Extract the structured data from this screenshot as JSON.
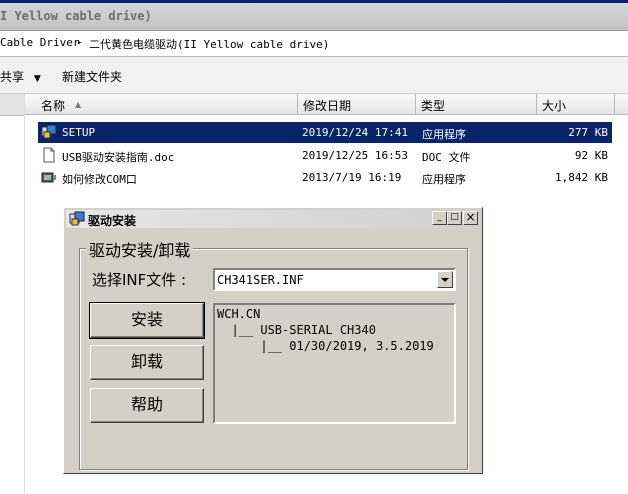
{
  "explorer": {
    "title_fragment": "I Yellow cable drive)",
    "address_path_1": "Cable Driver",
    "address_path_2": "二代黄色电缆驱动(II Yellow cable drive)",
    "toolbar": {
      "share": "共享",
      "new_folder": "新建文件夹"
    },
    "columns": {
      "name": "名称",
      "modified": "修改日期",
      "type": "类型",
      "size": "大小"
    },
    "files": [
      {
        "name": "SETUP",
        "modified": "2019/12/24 17:41",
        "type": "应用程序",
        "size": "277 KB",
        "icon": "setup-app-icon",
        "selected": true
      },
      {
        "name": "USB驱动安装指南.doc",
        "modified": "2019/12/25 16:53",
        "type": "DOC 文件",
        "size": "92 KB",
        "icon": "document-icon",
        "selected": false
      },
      {
        "name": "如何修改COM口",
        "modified": "2013/7/19 16:19",
        "type": "应用程序",
        "size": "1,842 KB",
        "icon": "app-icon",
        "selected": false
      }
    ]
  },
  "dialog": {
    "title": "驱动安装",
    "group_label": "驱动安装/卸载",
    "inf_label": "选择INF文件 :",
    "inf_value": "CH341SER.INF",
    "buttons": {
      "install": "安装",
      "uninstall": "卸载",
      "help": "帮助"
    },
    "info_lines": [
      "WCH.CN",
      "  |__ USB-SERIAL CH340",
      "      |__ 01/30/2019, 3.5.2019"
    ],
    "window_controls": {
      "minimize": "_",
      "maximize": "□",
      "close": "×"
    }
  }
}
